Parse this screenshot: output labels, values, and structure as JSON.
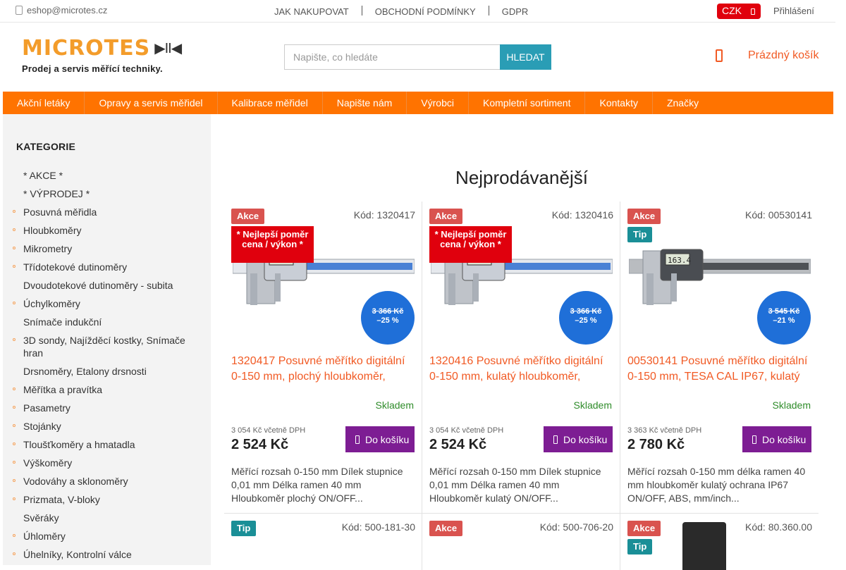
{
  "topbar": {
    "email": "eshop@microtes.cz",
    "links": [
      "JAK NAKUPOVAT",
      "OBCHODNÍ PODMÍNKY",
      "GDPR"
    ],
    "currency": "CZK",
    "login": "Přihlášení"
  },
  "header": {
    "logo_text": "MICROTES",
    "logo_controls": "▶II◀",
    "logo_tagline": "Prodej a servis měřící techniky.",
    "search_placeholder": "Napište, co hledáte",
    "search_button": "HLEDAT",
    "cart_label": "Prázdný košík"
  },
  "nav": [
    "Akční letáky",
    "Opravy a servis měřidel",
    "Kalibrace měřidel",
    "Napište nám",
    "Výrobci",
    "Kompletní sortiment",
    "Kontakty",
    "Značky"
  ],
  "sidebar": {
    "title": "KATEGORIE",
    "items": [
      {
        "label": "* AKCE *",
        "dot": false
      },
      {
        "label": "* VÝPRODEJ *",
        "dot": false
      },
      {
        "label": "Posuvná měřidla",
        "dot": true
      },
      {
        "label": "Hloubkoměry",
        "dot": true
      },
      {
        "label": "Mikrometry",
        "dot": true
      },
      {
        "label": "Třídotekové dutinoměry",
        "dot": true
      },
      {
        "label": "Dvoudotekové dutinoměry - subita",
        "dot": false
      },
      {
        "label": "Úchylkoměry",
        "dot": true
      },
      {
        "label": "Snímače indukční",
        "dot": false
      },
      {
        "label": "3D sondy, Najížděcí kostky, Snímače hran",
        "dot": true
      },
      {
        "label": "Drsnoměry, Etalony drsnosti",
        "dot": false
      },
      {
        "label": "Měřítka a pravítka",
        "dot": true
      },
      {
        "label": "Pasametry",
        "dot": true
      },
      {
        "label": "Stojánky",
        "dot": true
      },
      {
        "label": "Tloušťkoměry a hmatadla",
        "dot": true
      },
      {
        "label": "Výškoměry",
        "dot": true
      },
      {
        "label": "Vodováhy a sklonoměry",
        "dot": true
      },
      {
        "label": "Prizmata, V-bloky",
        "dot": true
      },
      {
        "label": "Svěráky",
        "dot": false
      },
      {
        "label": "Úhloměry",
        "dot": true
      },
      {
        "label": "Úhelníky, Kontrolní válce",
        "dot": true
      }
    ]
  },
  "main": {
    "heading": "Nejprodávanější",
    "products": [
      {
        "badges": [
          "Akce"
        ],
        "code": "Kód: 1320417",
        "best_label": "* Nejlepší poměr cena / výkon *",
        "old_price": "3 366 Kč",
        "discount": "–25 %",
        "title": "1320417 Posuvné měřítko digitální 0-150 mm, plochý hloubkoměr,",
        "stock": "Skladem",
        "price_vat": "3 054 Kč včetně DPH",
        "price": "2 524 Kč",
        "buy": "Do košíku",
        "desc": "Měřící rozsah 0-150 mm Dílek stupnice 0,01 mm Délka ramen 40 mm Hloubkoměr plochý ON/OFF..."
      },
      {
        "badges": [
          "Akce"
        ],
        "code": "Kód: 1320416",
        "best_label": "* Nejlepší poměr cena / výkon *",
        "old_price": "3 366 Kč",
        "discount": "–25 %",
        "title": "1320416 Posuvné měřítko digitální 0-150 mm, kulatý hloubkoměr,",
        "stock": "Skladem",
        "price_vat": "3 054 Kč včetně DPH",
        "price": "2 524 Kč",
        "buy": "Do košíku",
        "desc": "Měřící rozsah 0-150 mm Dílek stupnice 0,01 mm Délka ramen 40 mm Hloubkoměr kulatý ON/OFF..."
      },
      {
        "badges": [
          "Akce",
          "Tip"
        ],
        "code": "Kód: 00530141",
        "best_label": "",
        "old_price": "3 545 Kč",
        "discount": "–21 %",
        "title": "00530141 Posuvné měřítko digitální 0-150 mm, TESA CAL IP67, kulatý",
        "stock": "Skladem",
        "price_vat": "3 363 Kč včetně DPH",
        "price": "2 780 Kč",
        "buy": "Do košíku",
        "desc": "Měřící rozsah 0-150 mm délka ramen 40 mm hloubkoměr kulatý ochrana IP67 ON/OFF, ABS, mm/inch..."
      }
    ],
    "row2": [
      {
        "badges": [
          "Tip"
        ],
        "code": "Kód: 500-181-30"
      },
      {
        "badges": [
          "Akce"
        ],
        "code": "Kód: 500-706-20"
      },
      {
        "badges": [
          "Akce",
          "Tip"
        ],
        "code": "Kód: 80.360.00"
      }
    ]
  },
  "colors": {
    "accent": "#ff7300",
    "link": "#f15a24",
    "buy": "#7d1d93",
    "discount": "#1f6fd8",
    "akce": "#d9534f",
    "tip": "#1a8f97",
    "best": "#e0000d"
  }
}
